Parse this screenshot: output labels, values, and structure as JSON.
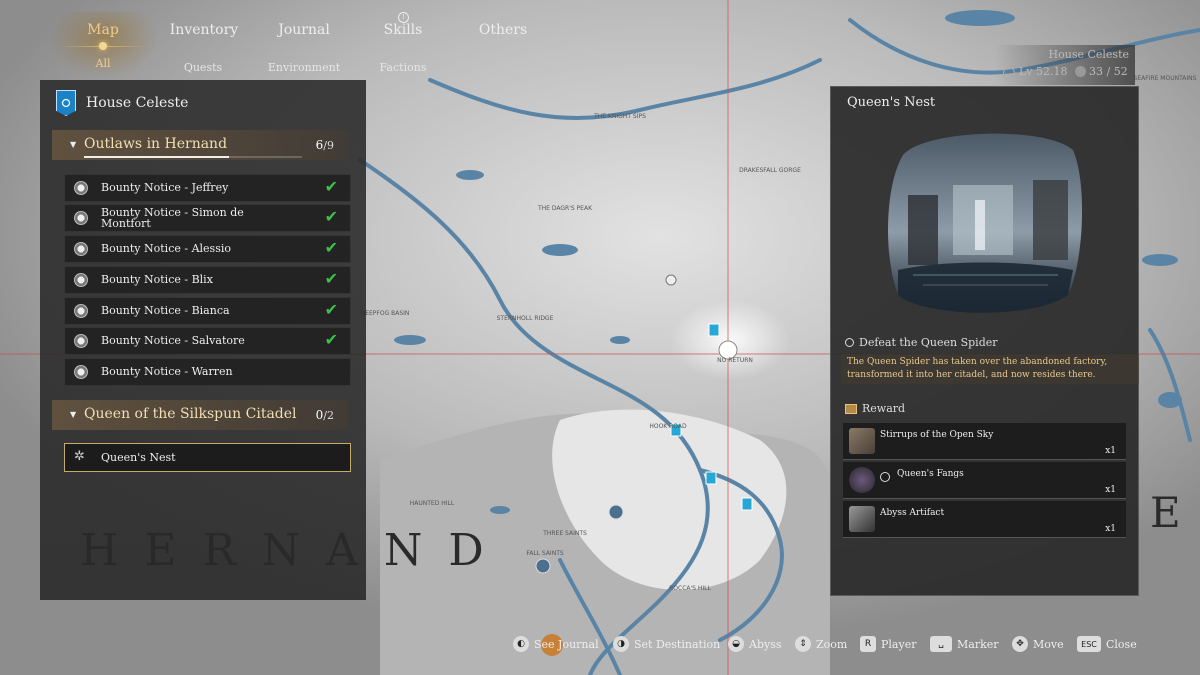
{
  "nav": {
    "tabs": [
      {
        "label": "Map",
        "sub": "All"
      },
      {
        "label": "Inventory",
        "sub": "Quests"
      },
      {
        "label": "Journal",
        "sub": "Environment"
      },
      {
        "label": "Skills",
        "sub": "Factions"
      },
      {
        "label": "Others"
      }
    ]
  },
  "house_status": {
    "name": "House Celeste",
    "level": "Lv 52.18",
    "count": "33 / 52"
  },
  "left_panel": {
    "faction": "House Celeste",
    "groups": [
      {
        "title": "Outlaws in Hernand",
        "progress_done": "6",
        "progress_total": "/9",
        "progress_fraction": 0.667,
        "quests": [
          {
            "label": "Bounty Notice - Jeffrey",
            "done": true
          },
          {
            "label": "Bounty Notice - Simon de Montfort",
            "done": true
          },
          {
            "label": "Bounty Notice - Alessio",
            "done": true
          },
          {
            "label": "Bounty Notice - Blix",
            "done": true
          },
          {
            "label": "Bounty Notice - Bianca",
            "done": true
          },
          {
            "label": "Bounty Notice - Salvatore",
            "done": true
          },
          {
            "label": "Bounty Notice - Warren",
            "done": false
          }
        ]
      },
      {
        "title": "Queen of the Silkspun Citadel",
        "progress_done": "0",
        "progress_total": "/2",
        "progress_fraction": 0.0,
        "quests": [
          {
            "label": "Queen's Nest",
            "done": false,
            "selected": true
          }
        ]
      }
    ]
  },
  "detail": {
    "title": "Queen's Nest",
    "objective": "Defeat the Queen Spider",
    "description": "The Queen Spider has taken over the abandoned factory, transformed it into her citadel, and now resides there.",
    "reward_label": "Reward",
    "rewards": [
      {
        "name": "Stirrups of the Open Sky",
        "qty": "x1",
        "icon": "stirrups-icon"
      },
      {
        "name": "Queen's Fangs",
        "qty": "x1",
        "icon": "fangs-icon"
      },
      {
        "name": "Abyss Artifact",
        "qty": "x1",
        "icon": "artifact-icon"
      }
    ]
  },
  "map": {
    "region_label": "HERNAND",
    "region_label_right": "E",
    "place_labels": [
      "THE KNIGHT SIPS",
      "DRAKESFALL GORGE",
      "THE DAGR'S PEAK",
      "STERNHOLL RIDGE",
      "DEEPFOG BASIN",
      "NO RETURN",
      "HOOK ROAD",
      "HAUNTED HILL",
      "THREE SAINTS",
      "FALL SAINTS",
      "ROCCA'S HILL",
      "SEAFIRE MOUNTAINS"
    ]
  },
  "controls": [
    {
      "icon": "mouse-icon",
      "label": "See Journal"
    },
    {
      "icon": "mouse-icon",
      "label": "Set Destination"
    },
    {
      "icon": "mouse-icon",
      "label": "Abyss"
    },
    {
      "icon": "scroll-icon",
      "label": "Zoom"
    },
    {
      "icon": "key-r",
      "key": "R",
      "label": "Player"
    },
    {
      "icon": "key-space",
      "key": "␣",
      "label": "Marker"
    },
    {
      "icon": "move-icon",
      "label": "Move"
    },
    {
      "icon": "key-esc",
      "key": "ESC",
      "label": "Close"
    }
  ],
  "colors": {
    "accent_gold": "#f2dfb4",
    "check_green": "#3cc14c",
    "water": "#5a84a6",
    "faction_blue": "#1b82c8"
  }
}
